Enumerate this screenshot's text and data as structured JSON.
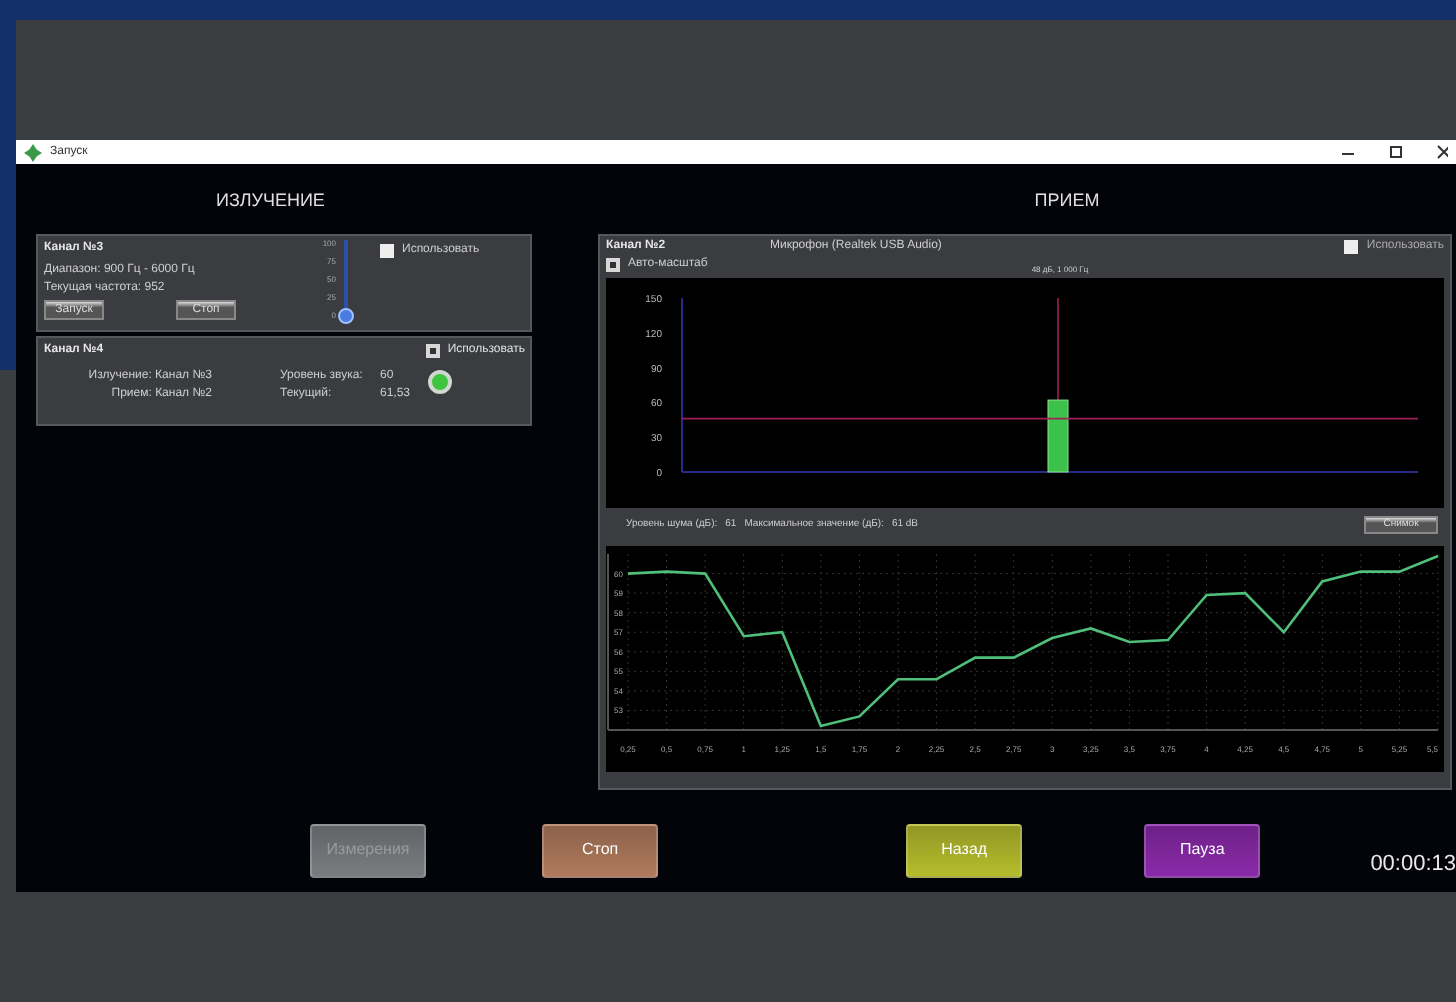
{
  "window": {
    "title": "Запуск"
  },
  "emission": {
    "title": "ИЗЛУЧЕНИЕ",
    "channel_3": {
      "name": "Канал №3",
      "range": "Диапазон: 900 Гц - 6000 Гц",
      "frequency": "Текущая частота: 952",
      "use": {
        "label": "Использовать",
        "checked": false
      },
      "buttons": [
        "Запуск",
        "Стоп"
      ],
      "slider": {
        "ticks": [
          "100",
          "75",
          "50",
          "25",
          "0"
        ],
        "level": 0
      }
    },
    "channel_4": {
      "name": "Канал №4",
      "use": {
        "label": "Использовать",
        "checked": true
      },
      "emission": "Излучение: Канал №3",
      "reception": "Прием: Канал №2",
      "sound_level_label": "Уровень звука:",
      "sound_level": "60",
      "current_label": "Текущий:",
      "current": "61,53",
      "indicator_on": true
    }
  },
  "reception": {
    "title": "ПРИЕМ",
    "channel": "Канал №2",
    "device": "Микрофон (Realtek USB Audio)",
    "use": {
      "label": "Использовать",
      "checked": false
    },
    "auto_scale": {
      "label": "Авто-масштаб",
      "checked": true
    },
    "peak_label": "48 дБ, 1 000 Гц",
    "spectrum": {
      "chart_data": {
        "type": "bar",
        "values": [
          62
        ],
        "ylim": [
          0,
          150
        ],
        "yticks": [
          0,
          30,
          60,
          90,
          120,
          150
        ],
        "ref_lines": [
          {
            "axis": "y",
            "value": 46
          }
        ]
      }
    },
    "noise_label": "Уровень шума (дБ):",
    "noise": "61",
    "max_label": "Максимальное значение (дБ):",
    "max": "61 dB",
    "snapshot_button": "Снимок",
    "history": {
      "chart_data": {
        "type": "line",
        "x": [
          0.25,
          0.5,
          0.75,
          1,
          1.25,
          1.5,
          1.75,
          2,
          2.25,
          2.5,
          2.75,
          3,
          3.25,
          3.5,
          3.75,
          4,
          4.25,
          4.5,
          4.75,
          5,
          5.25,
          5.5
        ],
        "xticks": [
          {
            "value": 0.25,
            "label": "0,25"
          },
          {
            "value": 0.5,
            "label": "0,5"
          },
          {
            "value": 0.75,
            "label": "0,75"
          },
          {
            "value": 1,
            "label": "1"
          },
          {
            "value": 1.25,
            "label": "1,25"
          },
          {
            "value": 1.5,
            "label": "1,5"
          },
          {
            "value": 1.75,
            "label": "1,75"
          },
          {
            "value": 2,
            "label": "2"
          },
          {
            "value": 2.25,
            "label": "2,25"
          },
          {
            "value": 2.5,
            "label": "2,5"
          },
          {
            "value": 2.75,
            "label": "2,75"
          },
          {
            "value": 3,
            "label": "3"
          },
          {
            "value": 3.25,
            "label": "3,25"
          },
          {
            "value": 3.5,
            "label": "3,5"
          },
          {
            "value": 3.75,
            "label": "3,75"
          },
          {
            "value": 4,
            "label": "4"
          },
          {
            "value": 4.25,
            "label": "4,25"
          },
          {
            "value": 4.5,
            "label": "4,5"
          },
          {
            "value": 4.75,
            "label": "4,75"
          },
          {
            "value": 5,
            "label": "5"
          },
          {
            "value": 5.25,
            "label": "5,25"
          },
          {
            "value": 5.5,
            "label": "5,5"
          }
        ],
        "xlim": [
          0.25,
          5.5
        ],
        "ylim": [
          52,
          61
        ],
        "yticks": [
          53,
          54,
          55,
          56,
          57,
          58,
          59,
          60
        ],
        "grid": true,
        "series": [
          {
            "color": "#4fbf7a",
            "values": [
              60.0,
              60.1,
              60.0,
              56.8,
              57.0,
              52.2,
              52.7,
              54.6,
              54.6,
              55.7,
              55.7,
              56.7,
              57.2,
              56.5,
              56.6,
              58.9,
              59.0,
              57.0,
              59.6,
              60.1,
              60.1,
              60.9
            ]
          }
        ]
      }
    }
  },
  "buttons": [
    {
      "label": "Измерения",
      "color": "#7a7d80",
      "disabled": true
    },
    {
      "label": "Стоп",
      "color": "#b07a5c",
      "disabled": false
    },
    {
      "label": "Назад",
      "color": "#b5bd2c",
      "disabled": false
    },
    {
      "label": "Пауза",
      "color": "#8a2aa8",
      "disabled": false
    }
  ],
  "timer": "00:00:13"
}
